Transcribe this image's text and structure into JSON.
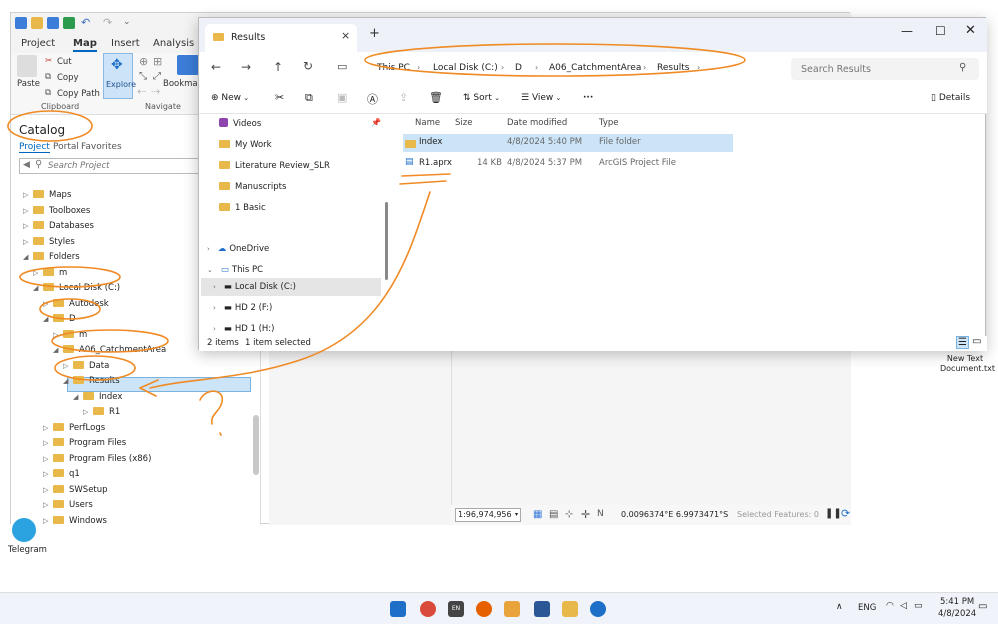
{
  "arcgis": {
    "ribbon_tabs": [
      "Project",
      "Map",
      "Insert",
      "Analysis"
    ],
    "active_tab": "Map",
    "clipboard": {
      "paste": "Paste",
      "cut": "Cut",
      "copy": "Copy",
      "copy_path": "Copy Path",
      "group": "Clipboard"
    },
    "navigate": {
      "explore": "Explore",
      "bookmarks": "Bookmarks",
      "group": "Navigate"
    },
    "catalog": {
      "title": "Catalog",
      "tabs": [
        "Project",
        "Portal",
        "Favorites"
      ],
      "search_placeholder": "Search Project",
      "tree": [
        {
          "label": "Maps",
          "indent": 0,
          "arrow": "▷"
        },
        {
          "label": "Toolboxes",
          "indent": 0,
          "arrow": "▷"
        },
        {
          "label": "Databases",
          "indent": 0,
          "arrow": "▷"
        },
        {
          "label": "Styles",
          "indent": 0,
          "arrow": "▷"
        },
        {
          "label": "Folders",
          "indent": 0,
          "arrow": "◢"
        },
        {
          "label": "m",
          "indent": 1,
          "arrow": "▷"
        },
        {
          "label": "Local Disk (C:)",
          "indent": 1,
          "arrow": "◢"
        },
        {
          "label": "Autodesk",
          "indent": 2,
          "arrow": "▷"
        },
        {
          "label": "D",
          "indent": 2,
          "arrow": "◢"
        },
        {
          "label": "m",
          "indent": 3,
          "arrow": "▷"
        },
        {
          "label": "A06_CatchmentArea",
          "indent": 3,
          "arrow": "◢"
        },
        {
          "label": "Data",
          "indent": 4,
          "arrow": "▷"
        },
        {
          "label": "Results",
          "indent": 4,
          "arrow": "◢"
        },
        {
          "label": "Index",
          "indent": 5,
          "arrow": "◢"
        },
        {
          "label": "R1",
          "indent": 6,
          "arrow": "▷"
        },
        {
          "label": "PerfLogs",
          "indent": 2,
          "arrow": "▷"
        },
        {
          "label": "Program Files",
          "indent": 2,
          "arrow": "▷"
        },
        {
          "label": "Program Files (x86)",
          "indent": 2,
          "arrow": "▷"
        },
        {
          "label": "q1",
          "indent": 2,
          "arrow": "▷"
        },
        {
          "label": "SWSetup",
          "indent": 2,
          "arrow": "▷"
        },
        {
          "label": "Users",
          "indent": 2,
          "arrow": "▷"
        },
        {
          "label": "Windows",
          "indent": 2,
          "arrow": "▷"
        }
      ]
    },
    "statusbar": {
      "scale": "1:96,974,956",
      "coords": "0.0096374°E 6.9973471°S",
      "selected": "Selected Features: 0"
    }
  },
  "explorer": {
    "tab_title": "Results",
    "breadcrumb": [
      "This PC",
      "Local Disk (C:)",
      "D",
      "A06_CatchmentArea",
      "Results"
    ],
    "search_placeholder": "Search Results",
    "toolbar": {
      "new": "New",
      "sort": "Sort",
      "view": "View",
      "details": "Details"
    },
    "nav_items": [
      "Videos",
      "My Work",
      "Literature Review_SLR",
      "Manuscripts",
      "1 Basic",
      "OneDrive",
      "This PC",
      "Local Disk (C:)",
      "HD 2 (F:)",
      "HD 1 (H:)"
    ],
    "columns": [
      "Name",
      "Size",
      "Date modified",
      "Type"
    ],
    "files": [
      {
        "name": "Index",
        "size": "",
        "date": "4/8/2024 5:40 PM",
        "type": "File folder"
      },
      {
        "name": "R1.aprx",
        "size": "14 KB",
        "date": "4/8/2024 5:37 PM",
        "type": "ArcGIS Project File"
      }
    ],
    "status": {
      "count": "2 items",
      "selected": "1 item selected"
    }
  },
  "desktop": {
    "icon_label": "New Text Document.txt",
    "telegram": "Telegram"
  },
  "taskbar": {
    "lang": "ENG",
    "time": "5:41 PM",
    "date": "4/8/2024"
  },
  "annotation": {
    "question": "?"
  },
  "colors": {
    "accent": "#0067c0",
    "folder": "#e8b94a",
    "annotation": "#f08a24",
    "selection": "#cce4f7"
  }
}
